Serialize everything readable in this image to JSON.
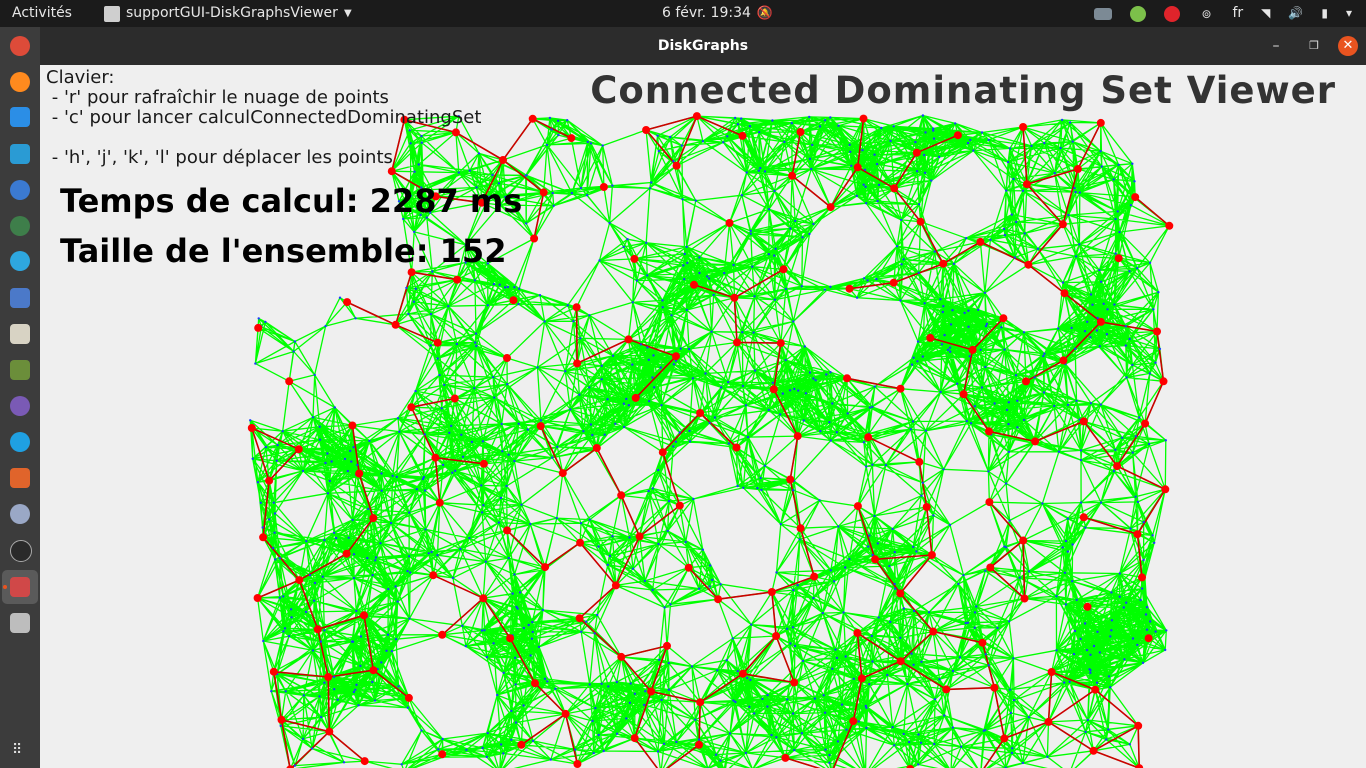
{
  "topbar": {
    "activities": "Activités",
    "app_menu": "supportGUI-DiskGraphsViewer",
    "clock": "6 févr.  19:34",
    "language": "fr"
  },
  "dock": {
    "icons": [
      "chrome-icon",
      "firefox-icon",
      "vscode-icon",
      "store-icon",
      "help-icon",
      "globe-icon",
      "telegram-icon",
      "document-icon",
      "window-icon",
      "minecraft-icon",
      "github-icon",
      "skype-icon",
      "java-icon",
      "microphone-icon",
      "settings-icon",
      "diskgraphs-icon",
      "trash-icon"
    ]
  },
  "window": {
    "title": "DiskGraphs"
  },
  "viewer": {
    "title": "Connected Dominating Set Viewer",
    "keyboard_header": "Clavier:",
    "hint_refresh": " - 'r' pour rafraîchir le nuage de points",
    "hint_compute": " - 'c' pour lancer calculConnectedDominatingSet",
    "hint_move": " - 'h', 'j', 'k', 'l' pour déplacer les points",
    "compute_time": "Temps de calcul: 2287 ms",
    "set_size": "Taille de l'ensemble: 152"
  },
  "graph": {
    "edge_color": "#00ff00",
    "point_color": "#1a3cff",
    "dominating_color": "#ff0000",
    "dominating_edge_color": "#cc0000"
  }
}
